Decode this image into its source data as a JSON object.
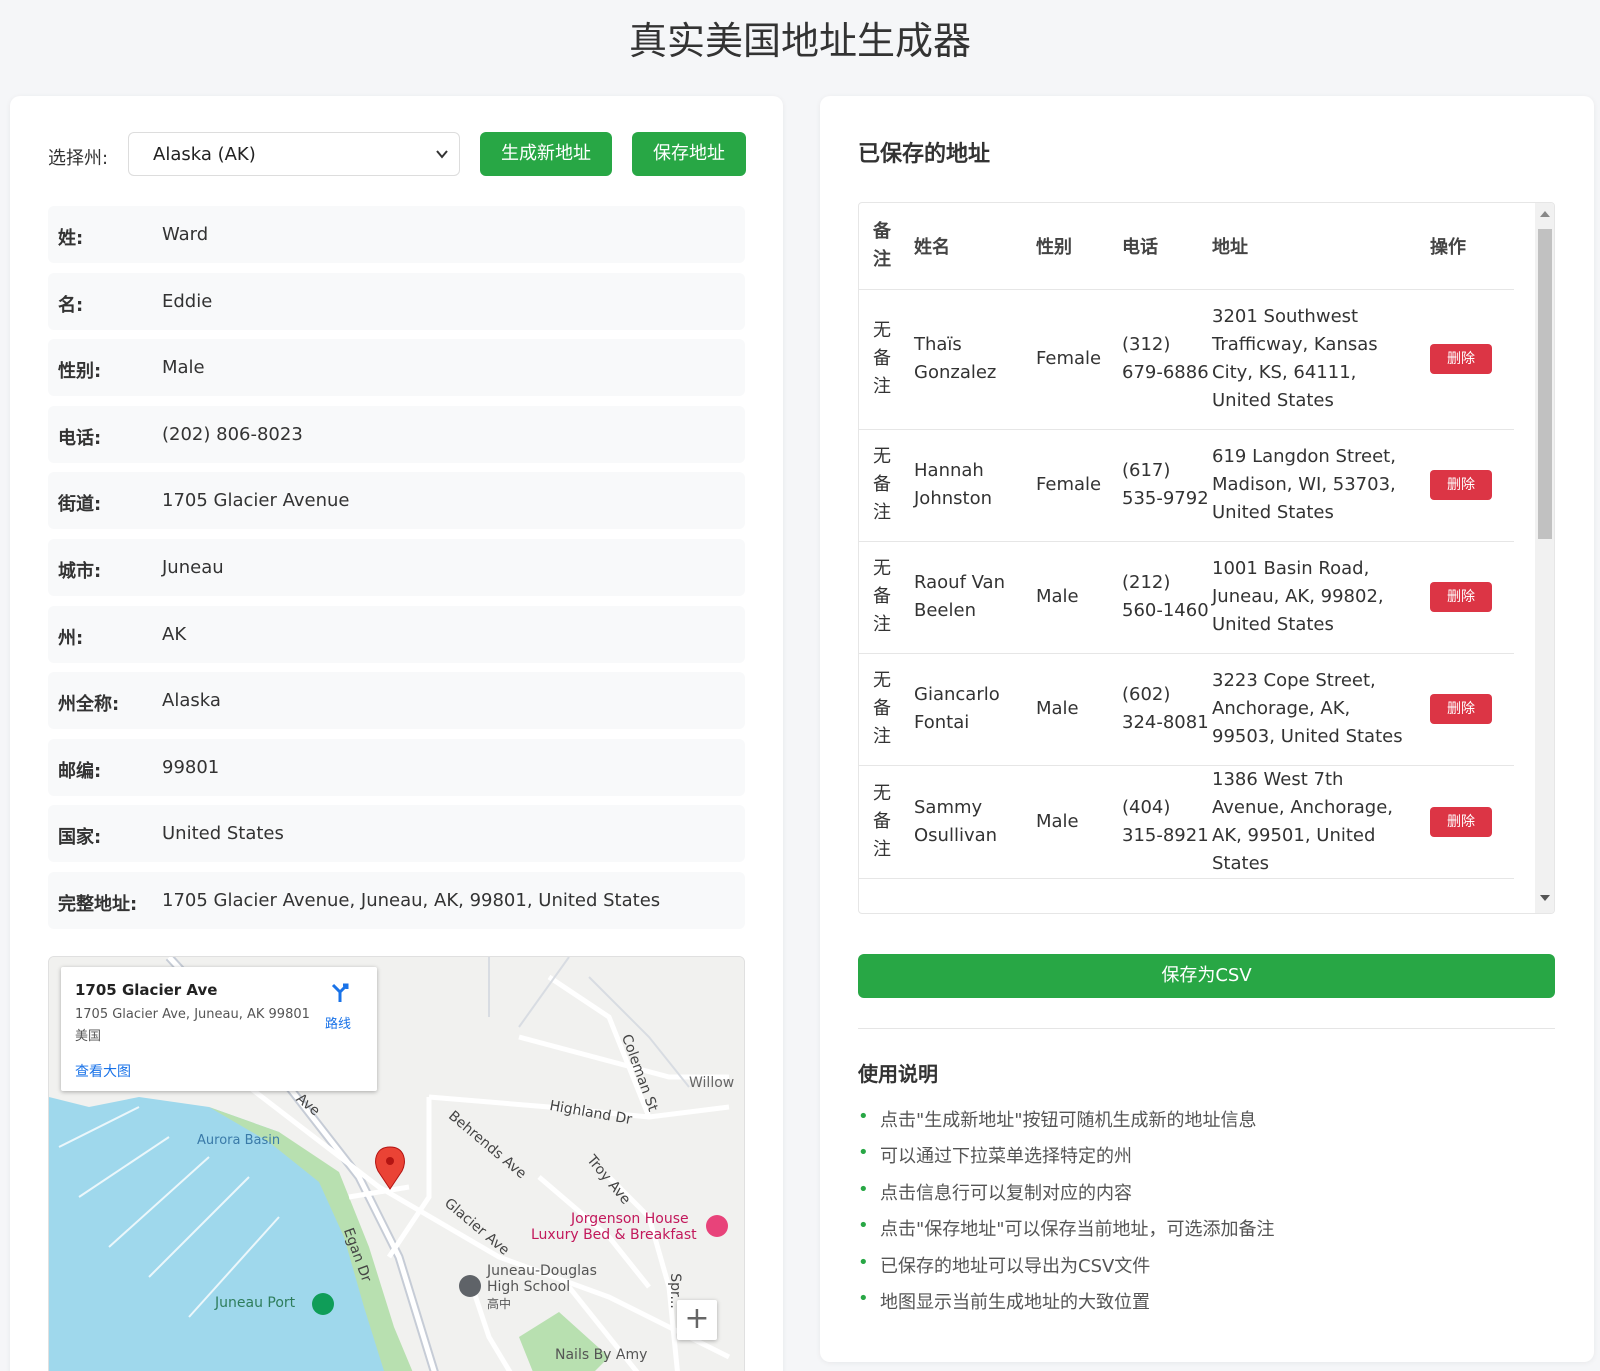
{
  "page": {
    "title": "真实美国地址生成器"
  },
  "controls": {
    "state_label": "选择州:",
    "state_value": "Alaska (AK)",
    "generate_label": "生成新地址",
    "save_label": "保存地址"
  },
  "fields": [
    {
      "key": "姓:",
      "value": "Ward"
    },
    {
      "key": "名:",
      "value": "Eddie"
    },
    {
      "key": "性别:",
      "value": "Male"
    },
    {
      "key": "电话:",
      "value": "(202) 806-8023"
    },
    {
      "key": "街道:",
      "value": "1705 Glacier Avenue"
    },
    {
      "key": "城市:",
      "value": "Juneau"
    },
    {
      "key": "州:",
      "value": "AK"
    },
    {
      "key": "州全称:",
      "value": "Alaska"
    },
    {
      "key": "邮编:",
      "value": "99801"
    },
    {
      "key": "国家:",
      "value": "United States"
    },
    {
      "key": "完整地址:",
      "value": "1705 Glacier Avenue, Juneau, AK, 99801, United States"
    }
  ],
  "map": {
    "popup_title": "1705 Glacier Ave",
    "popup_address": "1705 Glacier Ave, Juneau, AK 99801",
    "popup_country": "美国",
    "view_larger": "查看大图",
    "directions": "路线",
    "labels": {
      "aurora_basin": "Aurora Basin",
      "highland": "Highland Dr",
      "behrends": "Behrends Ave",
      "troy": "Troy Ave",
      "glacier": "Glacier Ave",
      "egan": "Egan Dr",
      "coleman": "Coleman St",
      "willow": "Willow",
      "ave": "Ave",
      "jorgenson_1": "Jorgenson House",
      "jorgenson_2": "Luxury Bed & Breakfast",
      "school_1": "Juneau-Douglas",
      "school_2": "High School",
      "school_3": "高中",
      "juneau_port": "Juneau Port",
      "nails": "Nails By Amy",
      "spr": "Spr..."
    },
    "zoom_in": "+"
  },
  "saved": {
    "title": "已保存的地址",
    "columns": [
      "备注",
      "姓名",
      "性别",
      "电话",
      "地址",
      "操作"
    ],
    "rows": [
      {
        "note": "无备注",
        "name": "Thaïs Gonzalez",
        "gender": "Female",
        "phone": "(312) 679-6886",
        "address": "3201 Southwest Trafficway, Kansas City, KS, 64111, United States",
        "action": "删除"
      },
      {
        "note": "无备注",
        "name": "Hannah Johnston",
        "gender": "Female",
        "phone": "(617) 535-9792",
        "address": "619 Langdon Street, Madison, WI, 53703, United States",
        "action": "删除"
      },
      {
        "note": "无备注",
        "name": "Raouf Van Beelen",
        "gender": "Male",
        "phone": "(212) 560-1460",
        "address": "1001 Basin Road, Juneau, AK, 99802, United States",
        "action": "删除"
      },
      {
        "note": "无备注",
        "name": "Giancarlo Fontai",
        "gender": "Male",
        "phone": "(602) 324-8081",
        "address": "3223 Cope Street, Anchorage, AK, 99503, United States",
        "action": "删除"
      },
      {
        "note": "无备注",
        "name": "Sammy Osullivan",
        "gender": "Male",
        "phone": "(404) 315-8921",
        "address": "1386 West 7th Avenue, Anchorage, AK, 99501, United States",
        "action": "删除"
      }
    ],
    "csv_label": "保存为CSV"
  },
  "usage": {
    "title": "使用说明",
    "items": [
      "点击\"生成新地址\"按钮可随机生成新的地址信息",
      "可以通过下拉菜单选择特定的州",
      "点击信息行可以复制对应的内容",
      "点击\"保存地址\"可以保存当前地址，可选添加备注",
      "已保存的地址可以导出为CSV文件",
      "地图显示当前生成地址的大致位置"
    ]
  },
  "colors": {
    "primary_green": "#28a745",
    "danger_red": "#dc3545",
    "link_blue": "#1a73e8",
    "water": "#9fd8ec"
  }
}
